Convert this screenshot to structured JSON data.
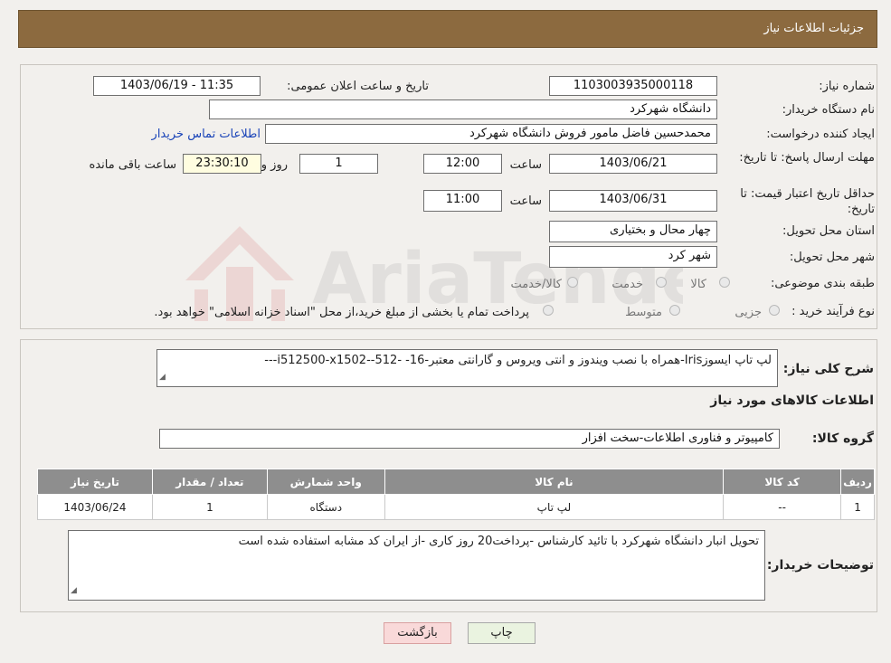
{
  "header": {
    "title": "جزئیات اطلاعات نیاز"
  },
  "fields": {
    "need_number_label": "شماره نیاز:",
    "need_number": "1103003935000118",
    "announce_label": "تاریخ و ساعت اعلان عمومی:",
    "announce_value": "1403/06/19 - 11:35",
    "buyer_org_label": "نام دستگاه خریدار:",
    "buyer_org": "دانشگاه شهرکرد",
    "requester_label": "ایجاد کننده درخواست:",
    "requester": "محمدحسین فاضل مامور فروش دانشگاه شهرکرد",
    "contact_link": "اطلاعات تماس خریدار",
    "deadline_label": "مهلت ارسال پاسخ: تا تاریخ:",
    "deadline_date": "1403/06/21",
    "time_label": "ساعت",
    "deadline_time": "12:00",
    "days_value": "1",
    "days_label": "روز و",
    "remaining_time": "23:30:10",
    "remaining_label": "ساعت باقی مانده",
    "validity_label": "حداقل تاریخ اعتبار قیمت: تا تاریخ:",
    "validity_date": "1403/06/31",
    "validity_time": "11:00",
    "province_label": "استان محل تحویل:",
    "province": "چهار محال و بختیاری",
    "city_label": "شهر محل تحویل:",
    "city": "شهر کرد",
    "category_label": "طبقه بندی موضوعی:",
    "category_options": [
      "کالا",
      "خدمت",
      "کالا/خدمت"
    ],
    "process_label": "نوع فرآیند خرید :",
    "process_options": [
      "جزیی",
      "متوسط"
    ],
    "process_note": "پرداخت تمام یا بخشی از مبلغ خرید،از محل \"اسناد خزانه اسلامی\" خواهد بود."
  },
  "description": {
    "label": "شرح کلی نیاز:",
    "text": "لپ تاپ ایسوزIris-همراه با نصب ویندوز و انتی ویروس و گارانتی معتبر-16-  -512--i512500-x1502---"
  },
  "goods_section": {
    "title": "اطلاعات کالاهای مورد نیاز",
    "group_label": "گروه کالا:",
    "group_value": "کامپیوتر و فناوری اطلاعات-سخت افزار"
  },
  "table": {
    "headers": [
      "ردیف",
      "کد کالا",
      "نام کالا",
      "واحد شمارش",
      "تعداد / مقدار",
      "تاریخ نیاز"
    ],
    "rows": [
      [
        "1",
        "--",
        "لپ تاپ",
        "دستگاه",
        "1",
        "1403/06/24"
      ]
    ]
  },
  "buyer_notes": {
    "label": "توضیحات خریدار:",
    "text": "تحویل انبار دانشگاه شهرکرد با تائید کارشناس -پرداخت20 روز کاری -از ایران کد مشابه استفاده شده است"
  },
  "buttons": {
    "print": "چاپ",
    "back": "بازگشت"
  },
  "watermark": {
    "text": "AriaTender.neT"
  },
  "colors": {
    "header_bg": "#8c6a3f",
    "table_header": "#8e8e8e",
    "link": "#1a44b8",
    "back_button": "#f9d9d9",
    "print_button": "#eaf3e0"
  }
}
